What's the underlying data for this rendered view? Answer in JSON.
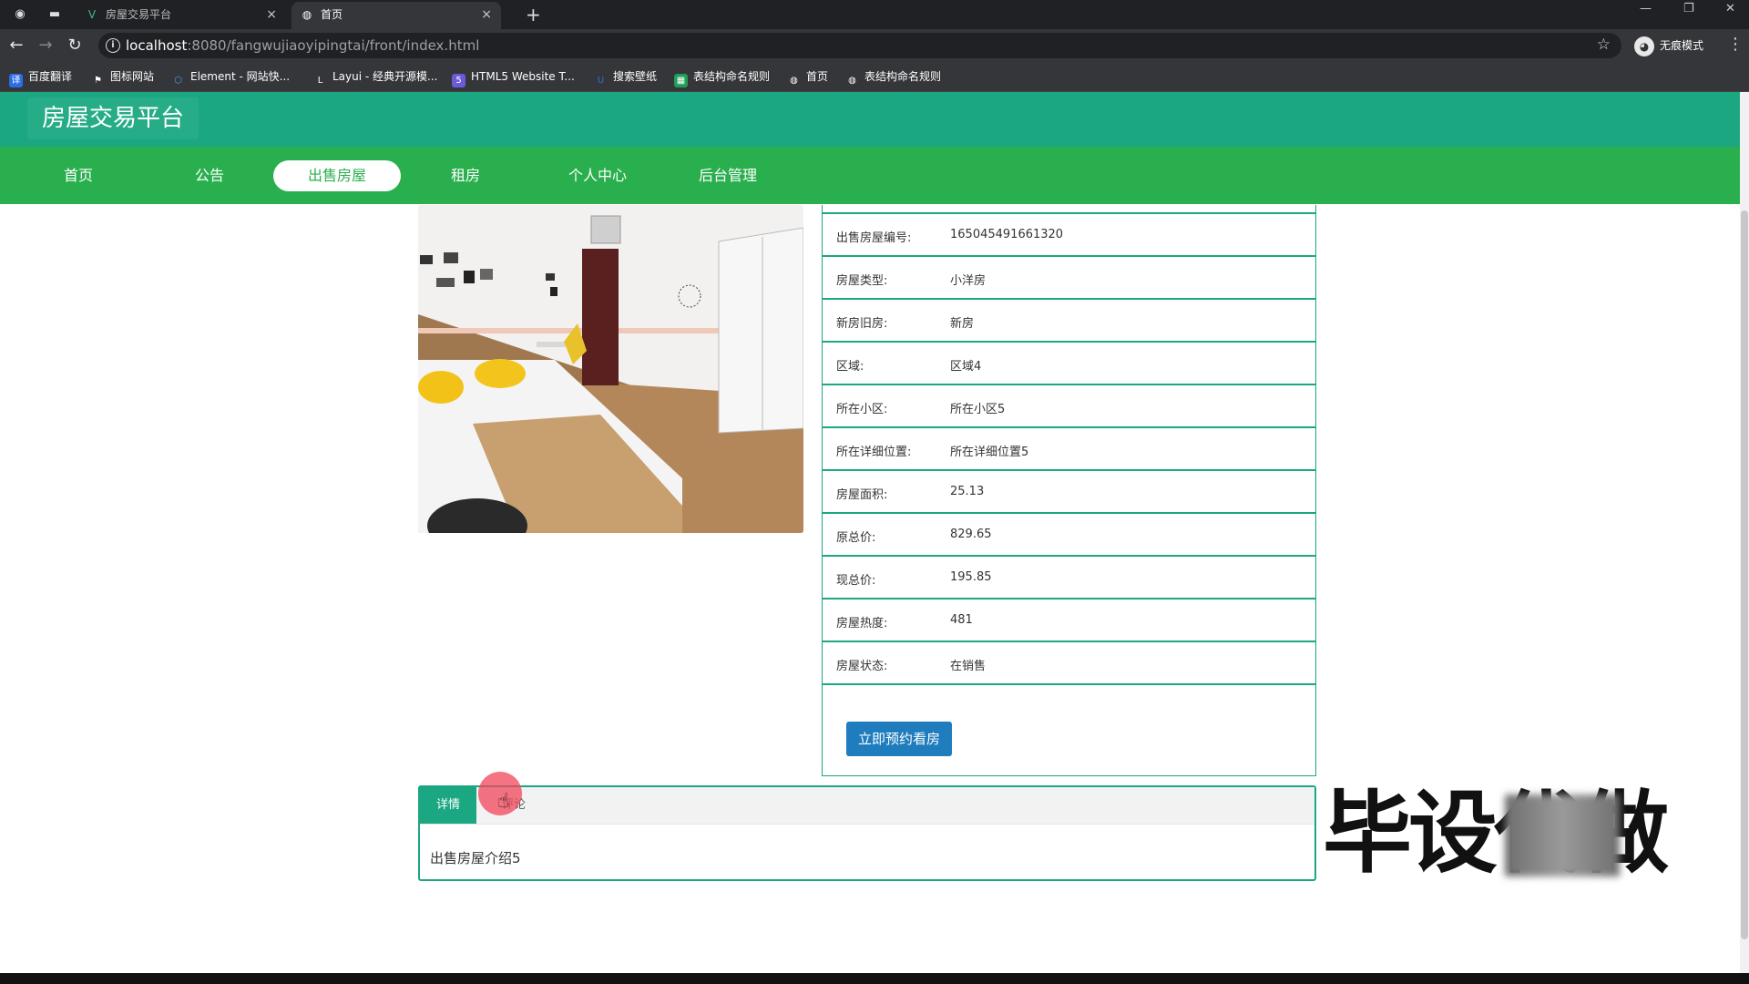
{
  "browser": {
    "tabs": [
      {
        "title": "房屋交易平台",
        "icon": "vue-icon",
        "active": false
      },
      {
        "title": "首页",
        "icon": "globe-icon",
        "active": true
      }
    ],
    "url_host": "localhost",
    "url_rest": ":8080/fangwujiaoyipingtai/front/index.html",
    "incognito_label": "无痕模式",
    "bookmarks": [
      {
        "label": "百度翻译",
        "color": "#2b6de5"
      },
      {
        "label": "图标网站",
        "color": "#444444"
      },
      {
        "label": "Element - 网站快...",
        "color": "#409eff"
      },
      {
        "label": "Layui - 经典开源模...",
        "color": "#555555"
      },
      {
        "label": "HTML5 Website T...",
        "color": "#6b5bd6"
      },
      {
        "label": "搜索壁纸",
        "color": "#3b6ad8"
      },
      {
        "label": "表结构命名规则",
        "color": "#1e9e57"
      },
      {
        "label": "首页",
        "color": "#666666"
      },
      {
        "label": "表结构命名规则",
        "color": "#666666"
      }
    ]
  },
  "site": {
    "title": "房屋交易平台",
    "nav": [
      "首页",
      "公告",
      "出售房屋",
      "租房",
      "个人中心",
      "后台管理"
    ],
    "active_nav": "出售房屋"
  },
  "house": {
    "rows": [
      {
        "label": "出售房屋编号:",
        "value": "165045491661320"
      },
      {
        "label": "房屋类型:",
        "value": "小洋房"
      },
      {
        "label": "新房旧房:",
        "value": "新房"
      },
      {
        "label": "区域:",
        "value": "区域4"
      },
      {
        "label": "所在小区:",
        "value": "所在小区5"
      },
      {
        "label": "所在详细位置:",
        "value": "所在详细位置5"
      },
      {
        "label": "房屋面积:",
        "value": "25.13"
      },
      {
        "label": "原总价:",
        "value": "829.65"
      },
      {
        "label": "现总价:",
        "value": "195.85"
      },
      {
        "label": "房屋热度:",
        "value": "481"
      },
      {
        "label": "房屋状态:",
        "value": "在销售"
      }
    ],
    "book_button": "立即预约看房"
  },
  "detail": {
    "tabs": [
      "详情",
      "评论"
    ],
    "text": "出售房屋介绍5"
  },
  "watermark": "毕设代做",
  "colors": {
    "header": "#1aa781",
    "nav": "#2aaf4e",
    "button": "#1f7dbd"
  }
}
